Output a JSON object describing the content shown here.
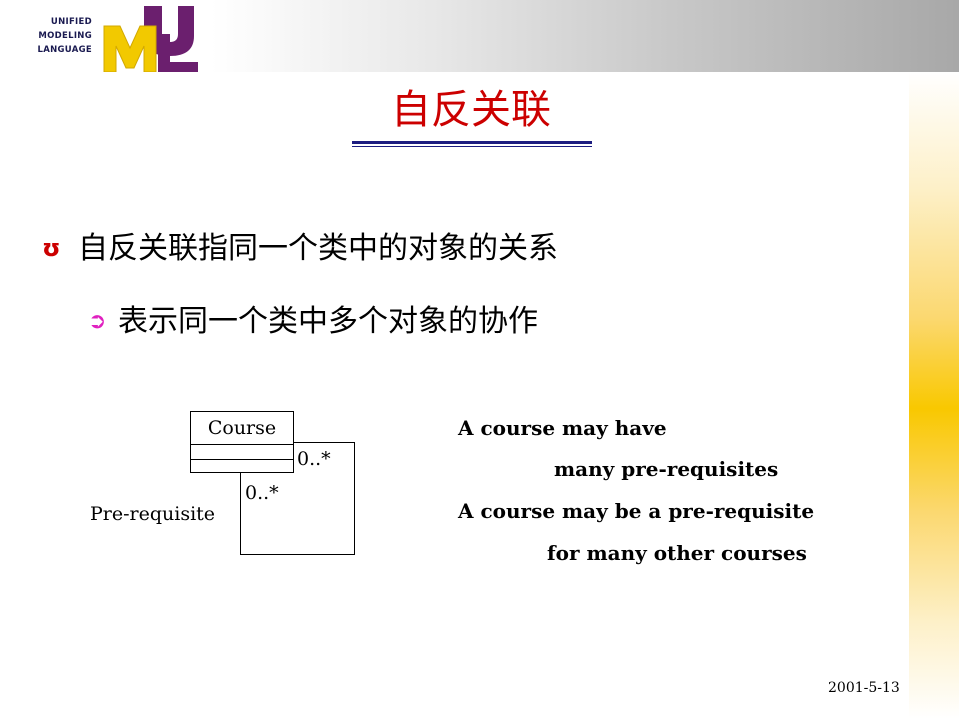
{
  "logo": {
    "line1": "UNIFIED",
    "line2": "MODELING",
    "line3": "LANGUAGE",
    "letters": [
      "U",
      "M",
      "L"
    ],
    "colors": {
      "u": "#6b1f6e",
      "m": "#f2c900",
      "l": "#6b1f6e"
    }
  },
  "slide": {
    "title": "自反关联",
    "title_color": "#cc0000",
    "rule_color": "#1c1c80",
    "bullets": [
      {
        "marker": "ʊ",
        "text": "自反关联指同一个类中的对象的关系",
        "marker_color": "#cc0000"
      },
      {
        "marker": "➲",
        "text": "表示同一个类中多个对象的协作",
        "marker_color": "#e020c0"
      }
    ]
  },
  "diagram": {
    "class_name": "Course",
    "multiplicity_top": "0..*",
    "multiplicity_left": "0..*",
    "role_name": "Pre-requisite"
  },
  "notes": [
    "A course may have",
    "many pre-requisites",
    "A course may be a pre-requisite",
    "for many other courses"
  ],
  "footer": {
    "date": "2001-5-13"
  }
}
